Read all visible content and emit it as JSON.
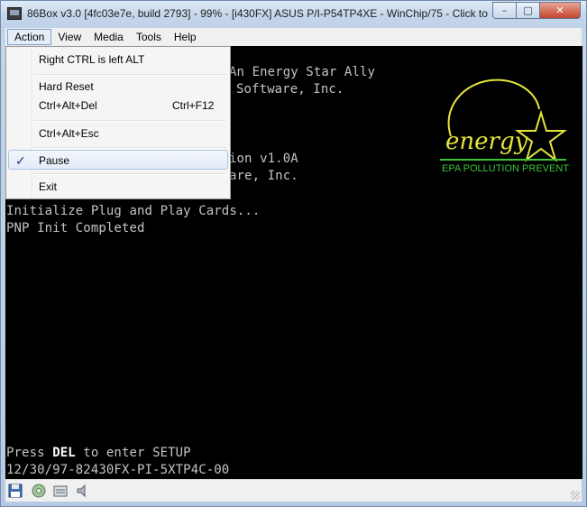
{
  "window": {
    "title": "86Box v3.0 [4fc03e7e, build 2793] - 99% - [i430FX] ASUS P/I-P54TP4XE - WinChip/75 - Click to ...",
    "caption_min": "–",
    "caption_max": "□",
    "caption_close": "✕"
  },
  "menubar": [
    "Action",
    "View",
    "Media",
    "Tools",
    "Help"
  ],
  "dropdown": {
    "items": [
      {
        "label": "Right CTRL is left ALT",
        "shortcut": ""
      },
      {
        "label": "Hard Reset",
        "shortcut": ""
      },
      {
        "label": "Ctrl+Alt+Del",
        "shortcut": "Ctrl+F12"
      },
      {
        "label": "Ctrl+Alt+Esc",
        "shortcut": ""
      },
      {
        "label": "Pause",
        "shortcut": "",
        "checked": true
      },
      {
        "label": "Exit",
        "shortcut": ""
      }
    ],
    "check_mark": "✓"
  },
  "bios": {
    "line1": "An Energy Star Ally",
    "line2": "Software, Inc.",
    "line3": "ion v1.0A",
    "line4": "are, Inc.",
    "line5": "Initialize Plug and Play Cards...",
    "line6": "PNP Init Completed",
    "setup_press": "Press ",
    "setup_key": "DEL",
    "setup_rest": " to enter SETUP",
    "bios_id": "12/30/97-82430FX-PI-5XTP4C-00",
    "energy_caption": "EPA POLLUTION PREVENTER",
    "energy_word": "energy"
  },
  "colors": {
    "bios_text": "#c4c4c4",
    "energy_yellow": "#e6e63a",
    "energy_green": "#39c43a"
  },
  "statusbar": {
    "icons": [
      "floppy-icon",
      "cdrom-icon",
      "hard-disk-icon",
      "sound-icon"
    ]
  }
}
